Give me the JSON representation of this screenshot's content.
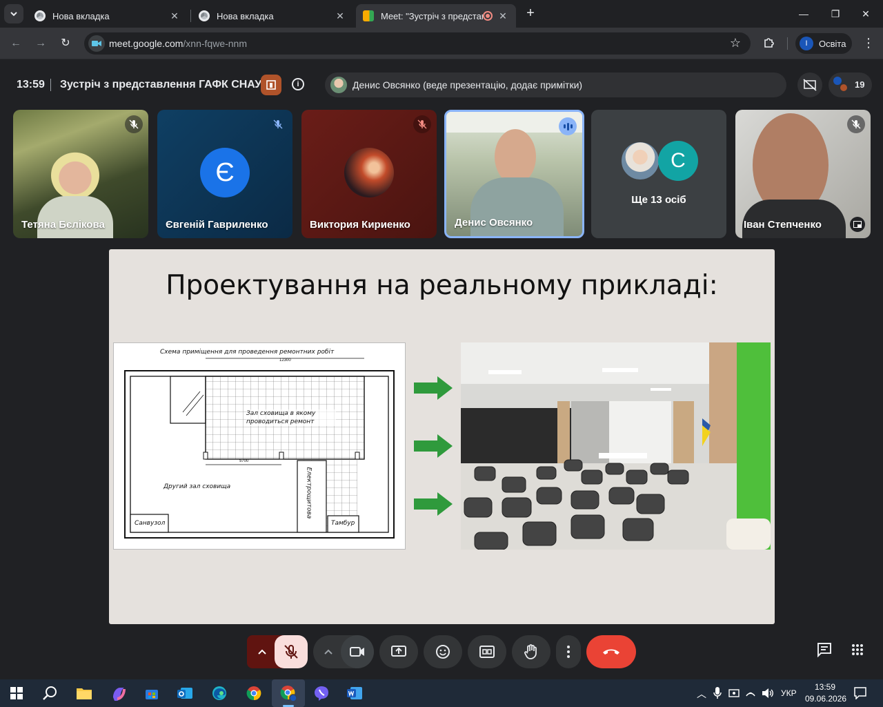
{
  "browser": {
    "tabs": [
      {
        "title": "Нова вкладка"
      },
      {
        "title": "Нова вкладка"
      },
      {
        "title": "Meet: \"Зустріч з представл"
      }
    ],
    "address": {
      "host": "meet.google.com",
      "path": "/xnn-fqwe-nnm"
    },
    "profile": {
      "initial": "І",
      "label": "Освіта"
    }
  },
  "meet": {
    "time": "13:59",
    "title": "Зустріч з представлення ГАФК СНАУ",
    "presenter_text": "Денис Овсянко (веде презентацію, додає примітки)",
    "people_count": "19",
    "participants": [
      {
        "name": "Тетяна Бєлікова",
        "muted": true
      },
      {
        "name": "Євгеній Гавриленко",
        "initial": "Є",
        "muted": true
      },
      {
        "name": "Виктория Кириенко",
        "muted": true
      },
      {
        "name": "Денис Овсянко",
        "speaking": true
      },
      {
        "name": "Ще 13 осіб",
        "initial": "С"
      },
      {
        "name": "Іван Степченко",
        "muted": true
      }
    ]
  },
  "slide": {
    "title": "Проектування на реальному прикладі:",
    "plan_labels": {
      "heading": "Схема приміщення для проведення ремонтних робіт",
      "hall": "Зал сховища в якому проводиться ремонт",
      "second_hall": "Другий зал сховища",
      "electrical": "Електрощитова",
      "bathroom": "Санвузол",
      "vestibule": "Тамбур",
      "dim_top": "12300",
      "dim_mid": "5700"
    }
  },
  "taskbar": {
    "lang": "УКР",
    "time": "13:59",
    "date": "09.06.2026"
  },
  "colors": {
    "accent_blue": "#8ab4f8",
    "end_call_red": "#ea4335",
    "arrow_green": "#2f9a3c"
  }
}
